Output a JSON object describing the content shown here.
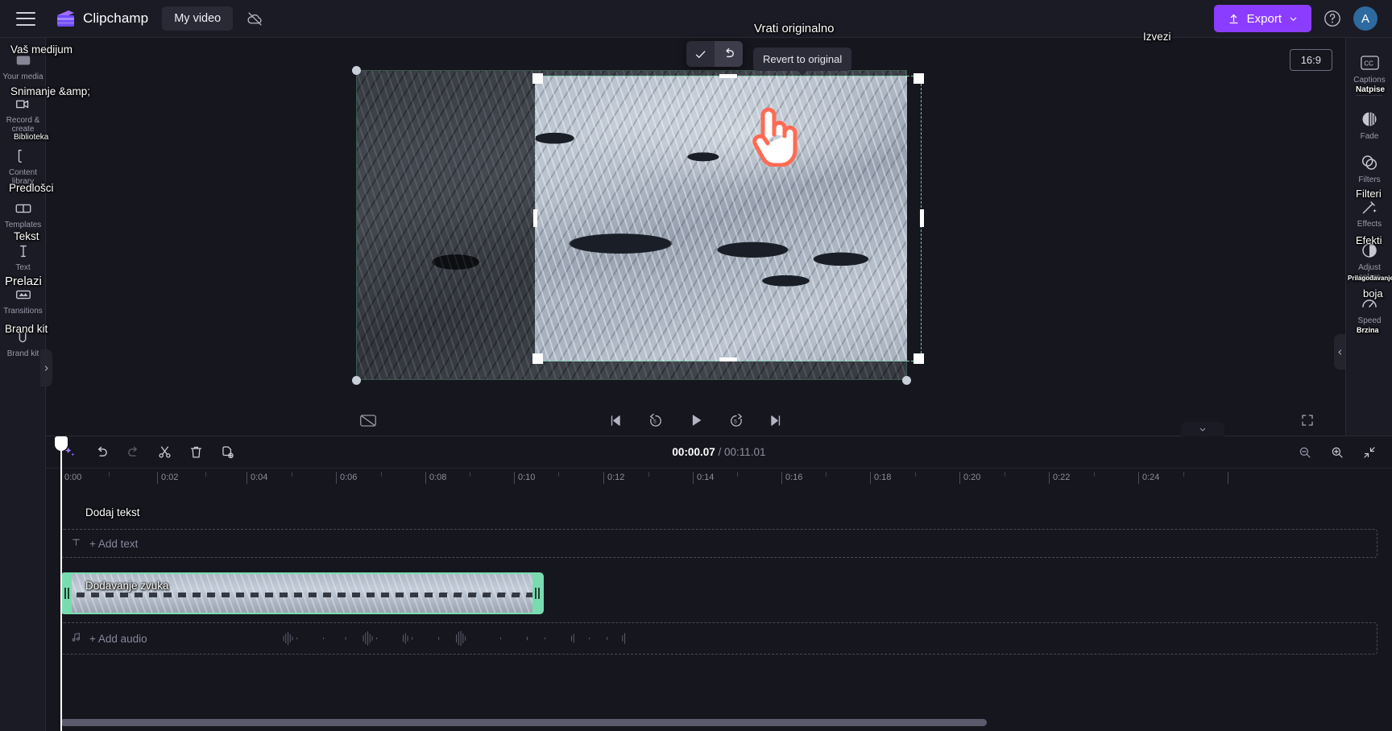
{
  "app": {
    "brand_name": "Clipchamp",
    "project_name": "My video",
    "cloud_status_icon": "cloud-off-icon",
    "menu_icon": "hamburger-menu-icon"
  },
  "topbar": {
    "export_label": "Export",
    "export_overlay": "Izvezi",
    "export_color": "#8b3dff",
    "help_icon": "help-circle-icon",
    "avatar_initial": "A"
  },
  "left_rail": {
    "items": [
      {
        "label": "Your media",
        "overlay": "Vaš medijum",
        "icon": "media-icon"
      },
      {
        "label": "Record & create",
        "overlay": "Snimanje &amp;",
        "icon": "record-create-icon"
      },
      {
        "label": "Content library",
        "overlay": "Biblioteka",
        "icon": "content-library-icon"
      },
      {
        "label": "Templates",
        "overlay": "Predlošci",
        "icon": "templates-icon"
      },
      {
        "label": "Text",
        "overlay": "Tekst",
        "icon": "text-icon"
      },
      {
        "label": "Transitions",
        "overlay": "Prelazi",
        "icon": "transitions-icon"
      },
      {
        "label": "Brand kit",
        "overlay": "Brand kit",
        "icon": "brand-kit-icon"
      }
    ],
    "collapse_icon": "chevron-right-icon"
  },
  "right_rail": {
    "items": [
      {
        "label": "Captions",
        "overlay": "Natpise",
        "icon": "captions-cc-icon"
      },
      {
        "label": "Fade",
        "overlay": "",
        "icon": "fade-icon"
      },
      {
        "label": "Filters",
        "overlay": "Filteri",
        "icon": "filters-icon"
      },
      {
        "label": "Effects",
        "overlay": "Efekti",
        "icon": "effects-wand-icon"
      },
      {
        "label": "Adjust colors",
        "overlay": "Prilagođavanje boja",
        "icon": "adjust-colors-icon"
      },
      {
        "label": "Speed",
        "overlay": "Brzina",
        "icon": "speed-icon"
      }
    ],
    "collapse_icon": "chevron-left-icon"
  },
  "stage": {
    "aspect_ratio": "16:9",
    "crop_toolbar": {
      "confirm_icon": "checkmark-icon",
      "revert_icon": "revert-undo-icon",
      "tooltip": "Revert to original",
      "tooltip_overlay": "Vrati originalno"
    },
    "cursor_icon": "pointing-hand-cursor"
  },
  "player": {
    "captions_toggle_icon": "captions-off-icon",
    "skip_start_icon": "skip-to-start-icon",
    "back5_icon": "rewind-5s-icon",
    "play_icon": "play-icon",
    "forward5_icon": "forward-5s-icon",
    "skip_end_icon": "skip-to-end-icon",
    "fullscreen_icon": "fullscreen-icon"
  },
  "timeline": {
    "toolbar": {
      "ai_icon": "magic-sparkles-icon",
      "undo_icon": "undo-icon",
      "redo_icon": "redo-icon",
      "split_icon": "scissors-split-icon",
      "delete_icon": "trash-delete-icon",
      "duplicate_icon": "duplicate-icon",
      "zoom_out_icon": "zoom-out-icon",
      "zoom_in_icon": "zoom-in-icon",
      "fit_icon": "fit-to-screen-icon",
      "drawer_icon": "chevron-down-icon"
    },
    "current_time": "00:00.07",
    "total_time": "00:11.01",
    "time_separator": "/",
    "ruler_labels": [
      "0:00",
      "0:02",
      "0:04",
      "0:06",
      "0:08",
      "0:10",
      "0:12",
      "0:14",
      "0:16",
      "0:18",
      "0:20",
      "0:22",
      "0:24"
    ],
    "tracks": {
      "text_track_label": "+ Add text",
      "text_track_overlay": "Dodaj tekst",
      "text_track_icon": "text-T-icon",
      "audio_track_label": "+ Add audio",
      "audio_track_overlay": "Dodavanje zvuka",
      "audio_track_icon": "music-note-icon",
      "video_clip_name": ""
    },
    "accent_clip_color": "#79dcb0"
  }
}
